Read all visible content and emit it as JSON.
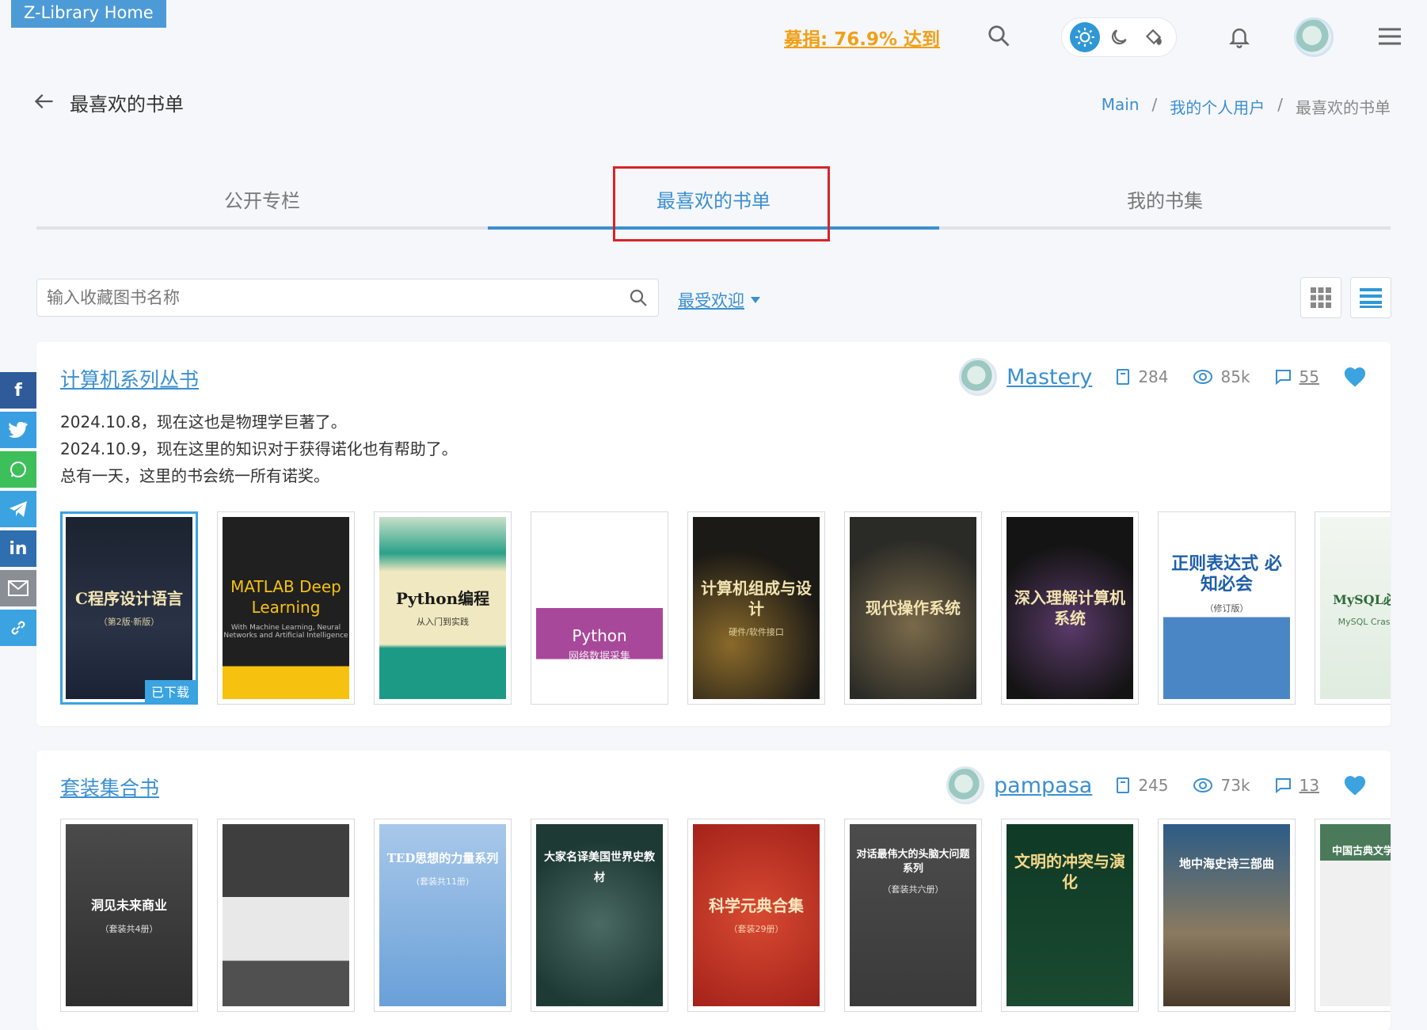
{
  "header": {
    "home_label": "Z-Library Home",
    "donate_label": "募捐: 76.9% 达到"
  },
  "page": {
    "title": "最喜欢的书单",
    "breadcrumb": [
      "Main",
      "我的个人用户",
      "最喜欢的书单"
    ]
  },
  "tabs": [
    "公开专栏",
    "最喜欢的书单",
    "我的书集"
  ],
  "search": {
    "placeholder": "输入收藏图书名称",
    "sort_label": "最受欢迎"
  },
  "colors": {
    "accent": "#3a8fd0",
    "donate": "#f0a018",
    "highlight": "#d8232a"
  },
  "social": [
    "facebook-icon",
    "twitter-icon",
    "whatsapp-icon",
    "telegram-icon",
    "linkedin-icon",
    "mail-icon",
    "link-icon"
  ],
  "lists": [
    {
      "title": "计算机系列丛书",
      "owner": "Mastery",
      "books_count": "284",
      "views": "85k",
      "comments": "55",
      "description": [
        "2024.10.8，现在这也是物理学巨著了。",
        "2024.10.9，现在这里的知识对于获得诺化也有帮助了。",
        "总有一天，这里的书会统一所有诺奖。"
      ],
      "books": [
        {
          "title": "C程序设计语言",
          "sub": "（第2版·新版）",
          "badge": "已下载"
        },
        {
          "title": "MATLAB Deep Learning",
          "sub": "With Machine Learning, Neural Networks and Artificial Intelligence"
        },
        {
          "title": "Python编程",
          "sub": "从入门到实践"
        },
        {
          "title": "Python",
          "sub": "网络数据采集"
        },
        {
          "title": "计算机组成与设计",
          "sub": "硬件/软件接口"
        },
        {
          "title": "现代操作系统",
          "sub": ""
        },
        {
          "title": "深入理解计算机系统",
          "sub": ""
        },
        {
          "title": "正则表达式 必知必会",
          "sub": "（修订版）"
        },
        {
          "title": "MySQL必知必会",
          "sub": "MySQL Crash Course"
        }
      ]
    },
    {
      "title": "套装集合书",
      "owner": "pampasa",
      "books_count": "245",
      "views": "73k",
      "comments": "13",
      "books": [
        {
          "title": "洞见未来商业",
          "sub": "（套装共4册）"
        },
        {
          "title": "",
          "sub": ""
        },
        {
          "title": "TED思想的力量系列",
          "sub": "(套装共11册)"
        },
        {
          "title": "大家名译美国世界史教材",
          "sub": ""
        },
        {
          "title": "科学元典合集",
          "sub": "（套装29册）"
        },
        {
          "title": "对话最伟大的头脑大问题系列",
          "sub": "（套装共六册）"
        },
        {
          "title": "文明的冲突与演化",
          "sub": ""
        },
        {
          "title": "地中海史诗三部曲",
          "sub": ""
        },
        {
          "title": "中国古典文学名家名译",
          "sub": ""
        }
      ]
    }
  ]
}
